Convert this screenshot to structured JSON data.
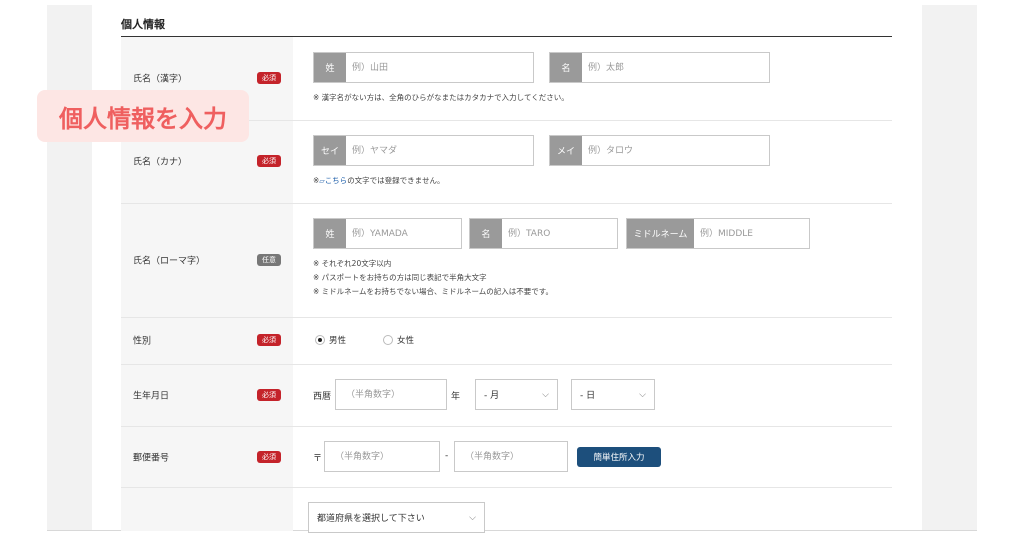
{
  "section": {
    "title": "個人情報"
  },
  "overlay": {
    "text": "個人情報を入力"
  },
  "badges": {
    "required": "必須",
    "optional": "任意"
  },
  "rows": {
    "kanji": {
      "label": "氏名（漢字）",
      "sei_prefix": "姓",
      "sei_placeholder": "例）山田",
      "mei_prefix": "名",
      "mei_placeholder": "例）太郎",
      "note": "※ 漢字名がない方は、全角のひらがなまたはカタカナで入力してください。"
    },
    "kana": {
      "label": "氏名（カナ）",
      "sei_prefix": "セイ",
      "sei_placeholder": "例）ヤマダ",
      "mei_prefix": "メイ",
      "mei_placeholder": "例）タロウ",
      "note_prefix": "※",
      "note_link": "こちら",
      "note_suffix": "の文字では登録できません。"
    },
    "romaji": {
      "label": "氏名（ローマ字）",
      "sei_prefix": "姓",
      "sei_placeholder": "例）YAMADA",
      "mei_prefix": "名",
      "mei_placeholder": "例）TARO",
      "middle_prefix": "ミドルネーム",
      "middle_placeholder": "例）MIDDLE",
      "notes": [
        "※ それぞれ20文字以内",
        "※ パスポートをお持ちの方は同じ表記で半角大文字",
        "※ ミドルネームをお持ちでない場合、ミドルネームの記入は不要です。"
      ]
    },
    "gender": {
      "label": "性別",
      "options": [
        "男性",
        "女性"
      ],
      "selected": "男性"
    },
    "birthdate": {
      "label": "生年月日",
      "era": "西暦",
      "year_placeholder": "（半角数字）",
      "year_unit": "年",
      "month_value": "- 月",
      "day_value": "- 日"
    },
    "postal": {
      "label": "郵便番号",
      "mark": "〒",
      "first_placeholder": "（半角数字）",
      "separator": "-",
      "second_placeholder": "（半角数字）",
      "button": "簡単住所入力"
    },
    "prefecture": {
      "select_value": "都道府県を選択して下さい"
    }
  }
}
